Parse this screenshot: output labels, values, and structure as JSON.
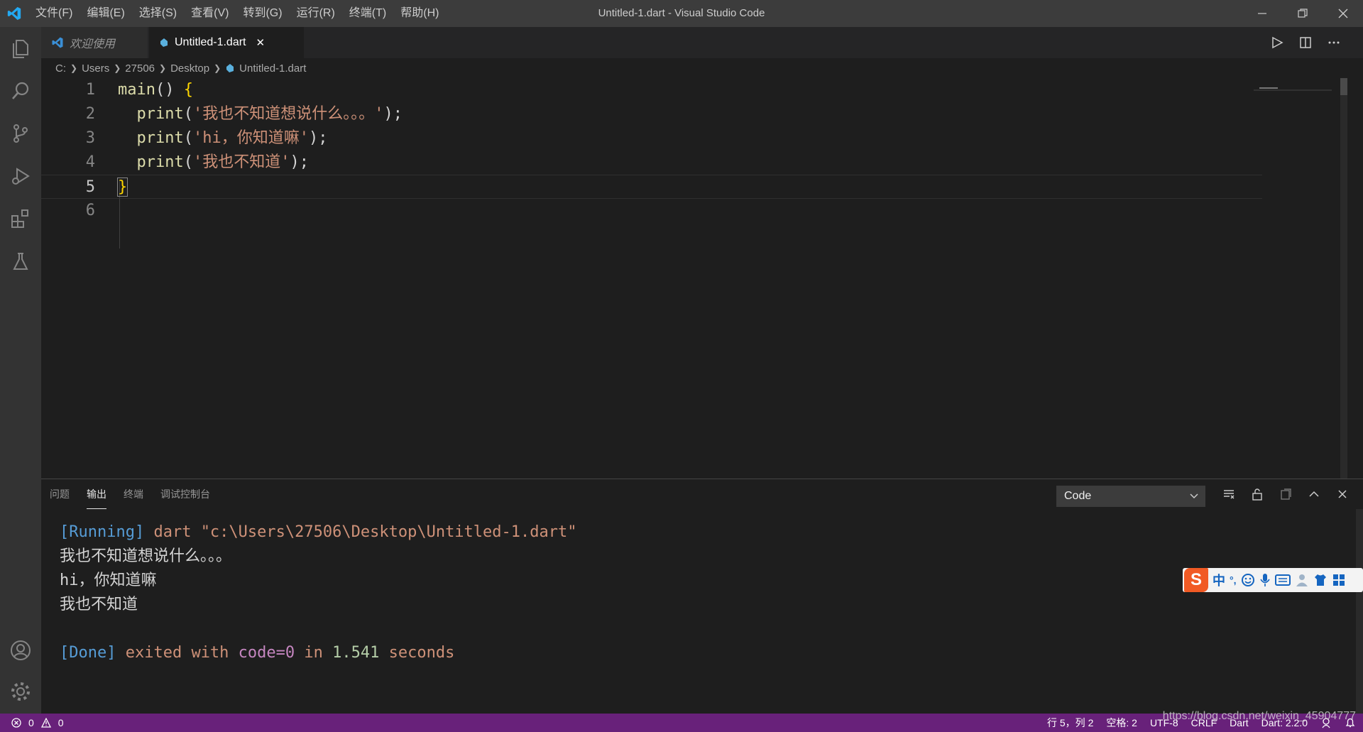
{
  "titlebar": {
    "menus": [
      "文件(F)",
      "编辑(E)",
      "选择(S)",
      "查看(V)",
      "转到(G)",
      "运行(R)",
      "终端(T)",
      "帮助(H)"
    ],
    "window_title": "Untitled-1.dart - Visual Studio Code"
  },
  "tabs": {
    "welcome": "欢迎使用",
    "file": "Untitled-1.dart",
    "close_glyph": "✕"
  },
  "breadcrumb": [
    "C:",
    "Users",
    "27506",
    "Desktop",
    "Untitled-1.dart"
  ],
  "editor": {
    "line_numbers": [
      "1",
      "2",
      "3",
      "4",
      "5",
      "6"
    ],
    "lines": [
      {
        "fn": "main",
        "rest": "() ",
        "brace": "{"
      },
      {
        "fn": "print",
        "open": "(",
        "str": "'我也不知道想说什么。。。'",
        "close": ");"
      },
      {
        "fn": "print",
        "open": "(",
        "str": "'hi，你知道嘛'",
        "close": ");"
      },
      {
        "fn": "print",
        "open": "(",
        "str": "'我也不知道'",
        "close": ");"
      },
      {
        "brace": "}"
      }
    ]
  },
  "panel": {
    "tabs": [
      "问题",
      "输出",
      "终端",
      "调试控制台"
    ],
    "active_tab": "输出",
    "channel": "Code",
    "output": {
      "running_tag": "[Running]",
      "running_cmd": " dart \"c:\\Users\\27506\\Desktop\\Untitled-1.dart\"",
      "lines": [
        "我也不知道想说什么。。。",
        "hi，你知道嘛",
        "我也不知道"
      ],
      "done_tag": "[Done]",
      "done_text": " exited with ",
      "done_code": "code=0",
      "done_in": " in ",
      "done_secs": "1.541",
      "done_seconds": " seconds"
    }
  },
  "ime": {
    "logo": "S",
    "lang": "中",
    "punct": "°,"
  },
  "statusbar": {
    "errors": "0",
    "warnings": "0",
    "position": "行 5，列 2",
    "spaces": "空格: 2",
    "encoding": "UTF-8",
    "eol": "CRLF",
    "language": "Dart",
    "sdk": "Dart: 2.2.0"
  },
  "watermark": "https://blog.csdn.net/weixin_45904777",
  "colors": {
    "statusbar": "#68217a",
    "activity_bar": "#333333",
    "string": "#ce9178",
    "function": "#dcdcaa"
  }
}
